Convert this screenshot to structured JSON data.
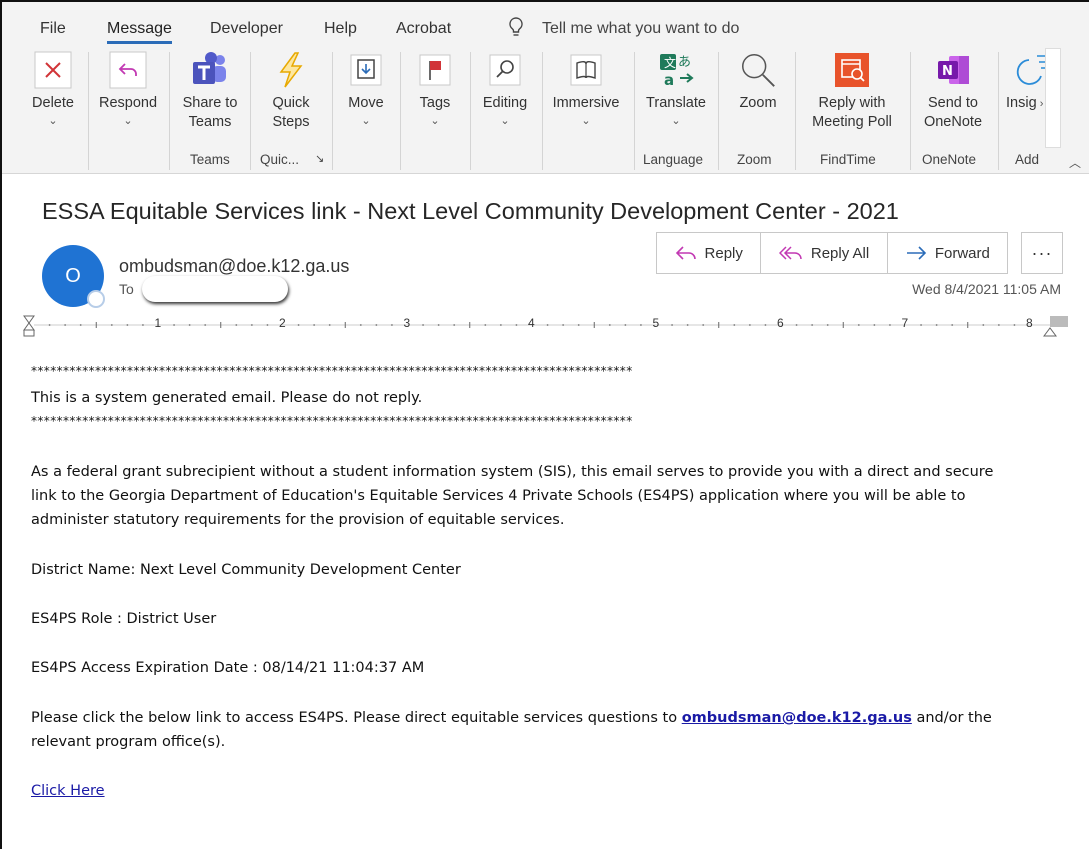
{
  "menu": {
    "items": [
      "File",
      "Message",
      "Developer",
      "Help",
      "Acrobat"
    ],
    "active": "Message",
    "tell_me": "Tell me what you want to do"
  },
  "ribbon": {
    "buttons": [
      {
        "label": "Delete",
        "icon": "close-icon",
        "color": "#d13438"
      },
      {
        "label": "Respond",
        "icon": "reply-icon",
        "color": "#c239b3"
      },
      {
        "label": "Share to Teams",
        "icon": "teams-icon",
        "color": "#5059c9"
      },
      {
        "label": "Quick Steps",
        "icon": "lightning-icon",
        "color": "#f4b400"
      },
      {
        "label": "Move",
        "icon": "move-icon",
        "color": "#444444"
      },
      {
        "label": "Tags",
        "icon": "flag-icon",
        "color": "#d13438"
      },
      {
        "label": "Editing",
        "icon": "search-icon",
        "color": "#444444"
      },
      {
        "label": "Immersive",
        "icon": "immersive-reader-icon",
        "color": "#444444"
      },
      {
        "label": "Translate",
        "icon": "translate-icon",
        "color": "#1f7a5a"
      },
      {
        "label": "Zoom",
        "icon": "magnifier-icon",
        "color": "#444444"
      },
      {
        "label": "Reply with Meeting Poll",
        "icon": "meeting-poll-icon",
        "color": "#e8532b"
      },
      {
        "label": "Send to OneNote",
        "icon": "onenote-icon",
        "color": "#7719aa"
      },
      {
        "label": "Insig",
        "icon": "insights-icon",
        "color": "#2b8cd8"
      }
    ],
    "groups": [
      "Teams",
      "Quic...",
      "Language",
      "Zoom",
      "FindTime",
      "OneNote",
      "Add"
    ]
  },
  "message": {
    "subject": "ESSA Equitable Services link - Next Level Community Development Center - 2021",
    "avatar_initial": "O",
    "sender": "ombudsman@doe.k12.ga.us",
    "to_label": "To",
    "date": "Wed 8/4/2021 11:05 AM",
    "actions": {
      "reply": "Reply",
      "reply_all": "Reply All",
      "forward": "Forward",
      "more": "···"
    }
  },
  "ruler": {
    "numbers": [
      "1",
      "2",
      "3",
      "4",
      "5",
      "6",
      "7",
      "8"
    ]
  },
  "body": {
    "stars": "**********************************************************************************************",
    "notice": "This is a system generated email. Please do not reply.",
    "para1_line1": "As a federal grant subrecipient without a student information system (SIS), this email serves to provide you with a direct and secure",
    "para1_line2": "link to the Georgia Department of Education's Equitable Services 4 Private Schools (ES4PS) application where you will be able to",
    "para1_line3": "administer statutory requirements for the provision of equitable services.",
    "district": "District Name: Next Level Community Development Center",
    "role": "ES4PS Role : District User",
    "expiration": "ES4PS Access Expiration Date : 08/14/21 11:04:37 AM",
    "para2_pre": "Please click the below link to access ES4PS. Please direct equitable services questions to ",
    "para2_link": "ombudsman@doe.k12.ga.us",
    "para2_post": " and/or the",
    "para2_line2": "relevant program office(s).",
    "click_here": "Click Here"
  }
}
